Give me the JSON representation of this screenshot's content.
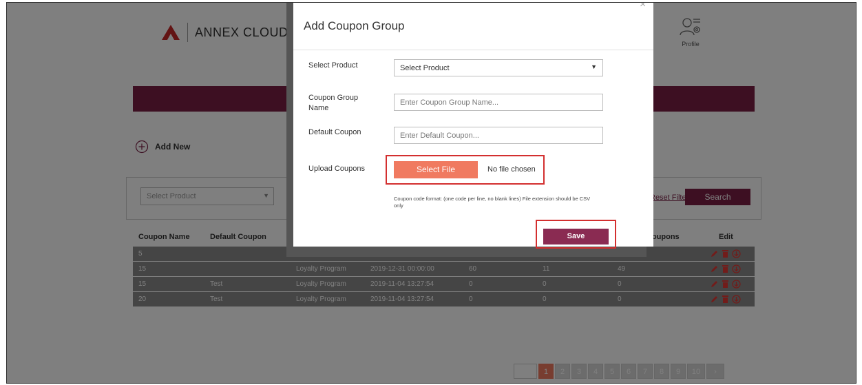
{
  "header": {
    "logo_text": "ANNEX CLOUD",
    "profile_label": "Profile"
  },
  "toolbar": {
    "add_new_label": "Add New"
  },
  "filters": {
    "select_product": "Select Product",
    "reset_label": "Reset Filters",
    "search_label": "Search"
  },
  "table": {
    "columns": [
      "Coupon Name",
      "Default Coupon",
      "Coupons",
      "Edit"
    ],
    "rows": [
      {
        "name": "5",
        "default": "",
        "program": "",
        "date": "",
        "c1": "",
        "c2": "",
        "c3": ""
      },
      {
        "name": "15",
        "default": "",
        "program": "Loyalty Program",
        "date": "2019-12-31 00:00:00",
        "c1": "60",
        "c2": "11",
        "c3": "49"
      },
      {
        "name": "15",
        "default": "Test",
        "program": "Loyalty Program",
        "date": "2019-11-04 13:27:54",
        "c1": "0",
        "c2": "0",
        "c3": "0"
      },
      {
        "name": "20",
        "default": "Test",
        "program": "Loyalty Program",
        "date": "2019-11-04 13:27:54",
        "c1": "0",
        "c2": "0",
        "c3": "0"
      }
    ]
  },
  "pagination": {
    "pages": [
      "1",
      "2",
      "3",
      "4",
      "5",
      "6",
      "7",
      "8",
      "9",
      "10"
    ],
    "next": "›"
  },
  "modal": {
    "title": "Add Coupon Group",
    "close": "×",
    "select_product_label": "Select Product",
    "select_product_value": "Select Product",
    "group_name_label": "Coupon Group Name",
    "group_name_placeholder": "Enter Coupon Group Name...",
    "default_coupon_label": "Default Coupon",
    "default_coupon_placeholder": "Enter Default Coupon...",
    "upload_label": "Upload Coupons",
    "select_file_label": "Select File",
    "no_file_label": "No file chosen",
    "format_note": "Coupon code format: (one code per line, no blank lines) File extension should be CSV only",
    "save_label": "Save"
  },
  "colors": {
    "brand": "#7a1f45",
    "accent": "#f07a60",
    "highlight": "#d32f2f"
  }
}
